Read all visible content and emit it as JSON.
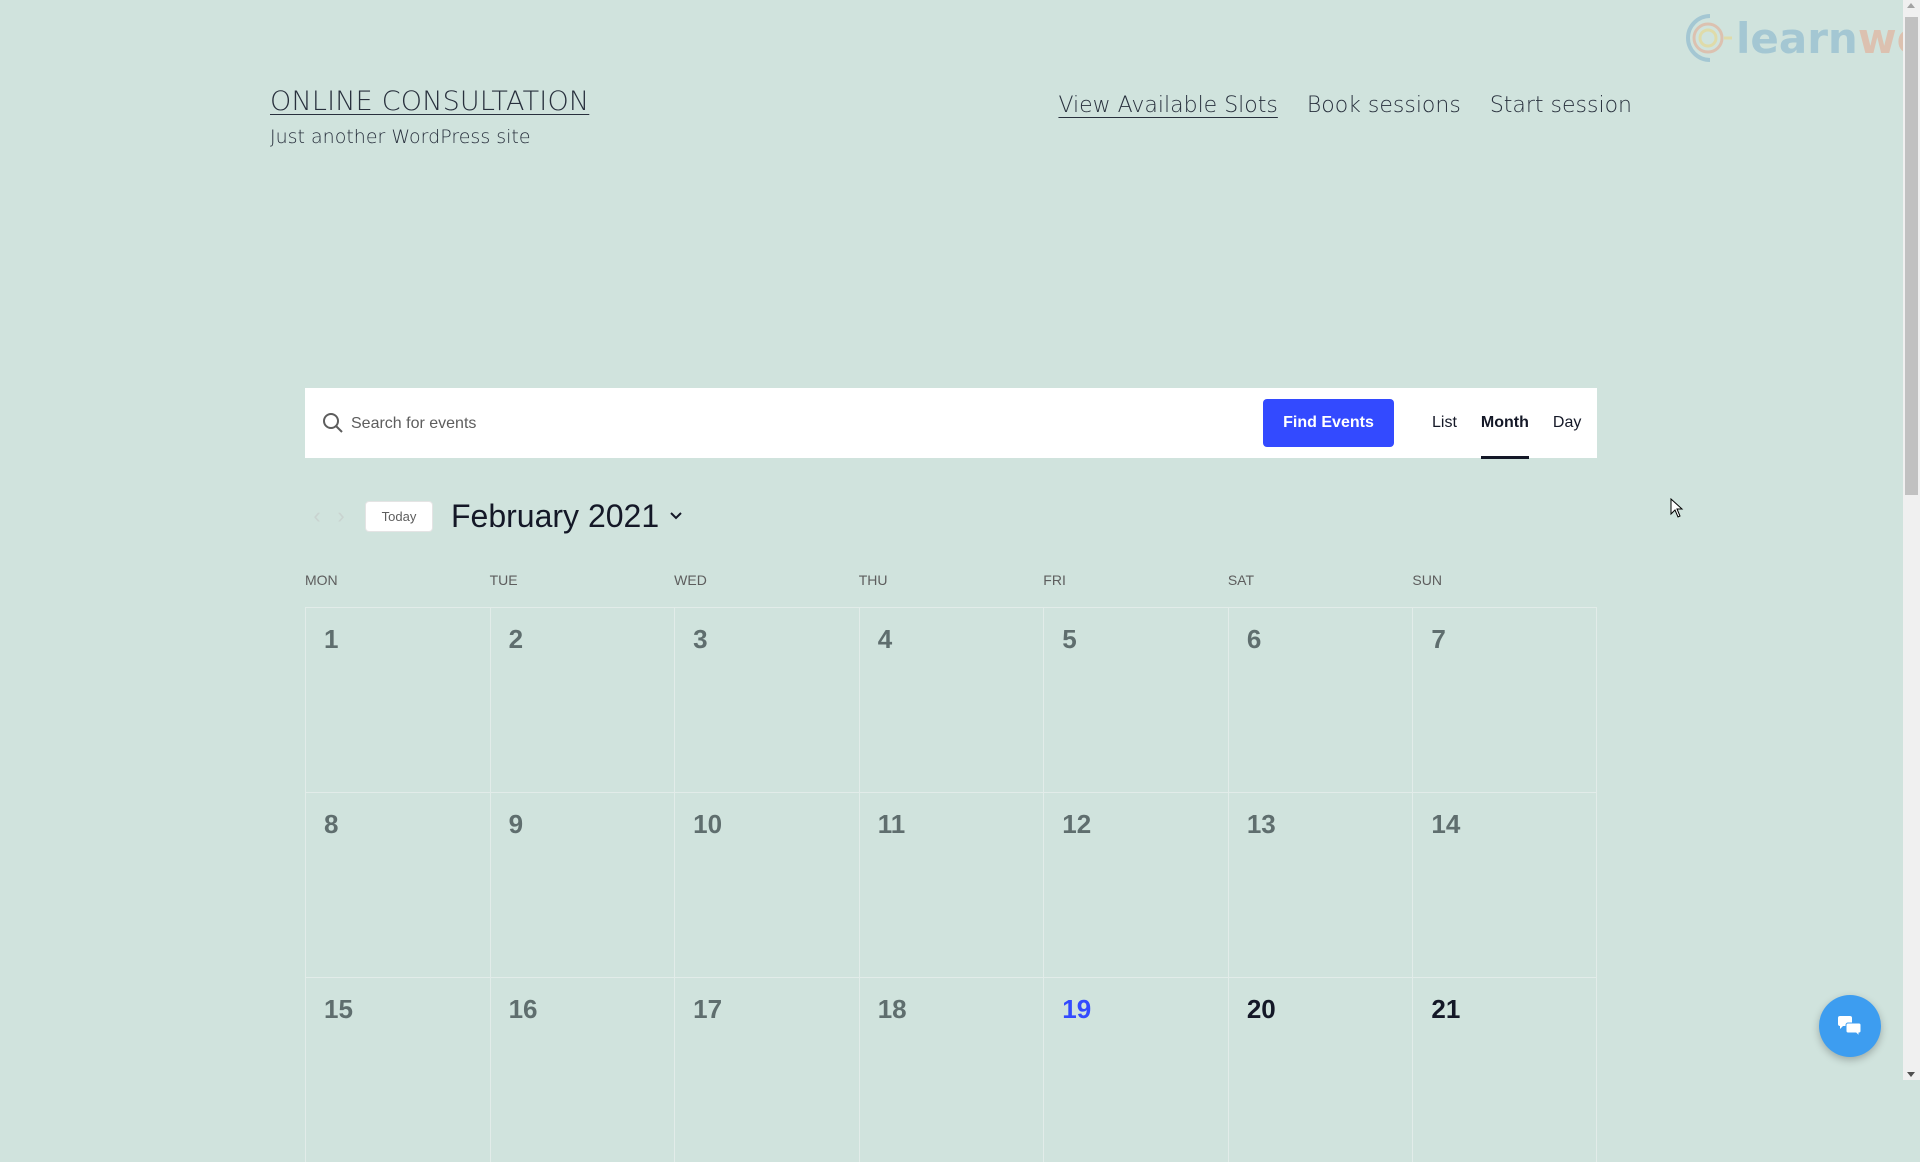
{
  "site": {
    "title": "ONLINE CONSULTATION",
    "tagline": "Just another WordPress site"
  },
  "nav": {
    "items": [
      {
        "label": "View Available Slots",
        "current": true
      },
      {
        "label": "Book sessions",
        "current": false
      },
      {
        "label": "Start session",
        "current": false
      }
    ]
  },
  "watermark": {
    "part1": "learn",
    "part2": "woo"
  },
  "search": {
    "placeholder": "Search for events",
    "value": "",
    "find_label": "Find Events",
    "icon": "search-icon"
  },
  "views": {
    "tabs": [
      {
        "label": "List",
        "active": false
      },
      {
        "label": "Month",
        "active": true
      },
      {
        "label": "Day",
        "active": false
      }
    ]
  },
  "date_nav": {
    "prev_icon": "chevron-left-icon",
    "next_icon": "chevron-right-icon",
    "today_label": "Today",
    "month_label": "February 2021",
    "dropdown_icon": "chevron-down-icon"
  },
  "calendar": {
    "day_headers": [
      "MON",
      "TUE",
      "WED",
      "THU",
      "FRI",
      "SAT",
      "SUN"
    ],
    "today": 19,
    "days": [
      1,
      2,
      3,
      4,
      5,
      6,
      7,
      8,
      9,
      10,
      11,
      12,
      13,
      14,
      15,
      16,
      17,
      18,
      19,
      20,
      21
    ],
    "colors": {
      "past": "#5f6e6e",
      "today": "#334aff",
      "future": "#141827"
    }
  },
  "chat": {
    "icon": "chat-bubbles-icon"
  },
  "colors": {
    "background": "#d0e3dd",
    "accent": "#334aff",
    "chat": "#3d9df0"
  }
}
